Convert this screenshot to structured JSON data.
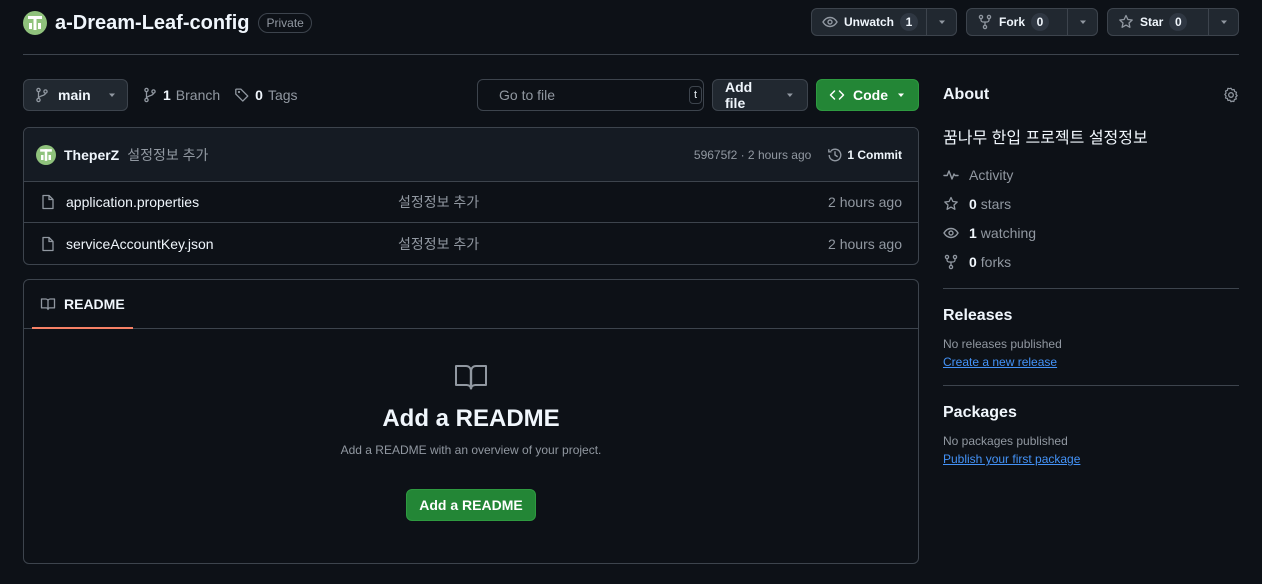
{
  "header": {
    "repo_name": "a-Dream-Leaf-config",
    "visibility": "Private",
    "unwatch": {
      "label": "Unwatch",
      "count": "1"
    },
    "fork": {
      "label": "Fork",
      "count": "0"
    },
    "star": {
      "label": "Star",
      "count": "0"
    }
  },
  "toolbar": {
    "branch": "main",
    "branch_count": "1",
    "branch_label": "Branch",
    "tag_count": "0",
    "tag_label": "Tags",
    "search_placeholder": "Go to file",
    "search_shortcut": "t",
    "add_file": "Add file",
    "code": "Code"
  },
  "latest_commit": {
    "author": "TheperZ",
    "message": "설정정보 추가",
    "hash_time": "59675f2 · 2 hours ago",
    "commit_count": "1 Commit"
  },
  "files": [
    {
      "name": "application.properties",
      "message": "설정정보 추가",
      "time": "2 hours ago"
    },
    {
      "name": "serviceAccountKey.json",
      "message": "설정정보 추가",
      "time": "2 hours ago"
    }
  ],
  "readme": {
    "tab": "README",
    "title": "Add a README",
    "subtitle": "Add a README with an overview of your project.",
    "button": "Add a README"
  },
  "about": {
    "title": "About",
    "description": "꿈나무 한입 프로젝트 설정정보",
    "activity": "Activity",
    "stars_count": "0",
    "stars_label": "stars",
    "watching_count": "1",
    "watching_label": "watching",
    "forks_count": "0",
    "forks_label": "forks"
  },
  "releases": {
    "title": "Releases",
    "empty": "No releases published",
    "link": "Create a new release"
  },
  "packages": {
    "title": "Packages",
    "empty": "No packages published",
    "link": "Publish your first package"
  },
  "colors": {
    "background": "#0d1117",
    "border": "#3d444d",
    "accent_green": "#238636",
    "link_blue": "#4493f8",
    "tab_underline": "#f78166"
  }
}
